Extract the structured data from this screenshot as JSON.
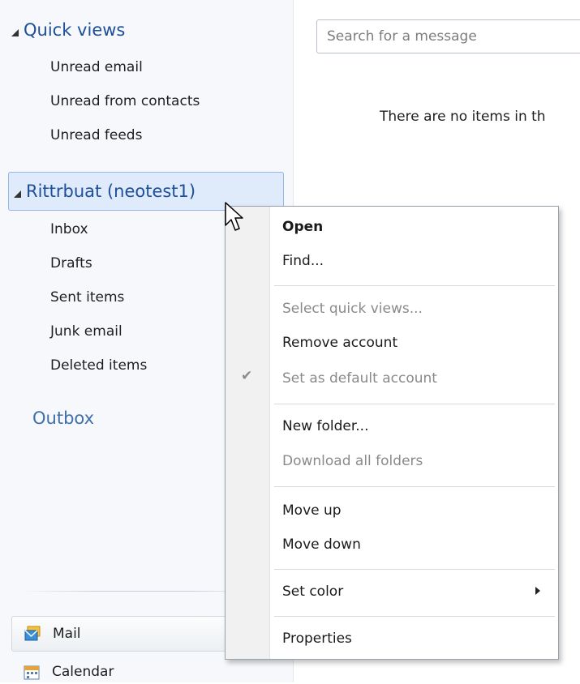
{
  "sidebar": {
    "quick_views": {
      "header": "Quick views",
      "items": [
        "Unread email",
        "Unread from contacts",
        "Unread feeds"
      ]
    },
    "account": {
      "header": "Rittrbuat (neotest1)",
      "folders": [
        "Inbox",
        "Drafts",
        "Sent items",
        "Junk email",
        "Deleted items"
      ]
    },
    "outbox": "Outbox",
    "nav": {
      "mail": "Mail",
      "calendar": "Calendar"
    }
  },
  "main": {
    "search_placeholder": "Search for a message",
    "empty_message": "There are no items in th"
  },
  "context_menu": {
    "open": "Open",
    "find": "Find...",
    "select_quick_views": "Select quick views...",
    "remove_account": "Remove account",
    "set_default": "Set as default account",
    "set_default_checked": true,
    "new_folder": "New folder...",
    "download_all": "Download all folders",
    "move_up": "Move up",
    "move_down": "Move down",
    "set_color": "Set color",
    "properties": "Properties",
    "check_glyph": "✔"
  },
  "colors": {
    "link_blue": "#1e4f99",
    "selection": "#dfeafb",
    "selection_border": "#93b7e8",
    "disabled_text": "#8a8a8a"
  }
}
